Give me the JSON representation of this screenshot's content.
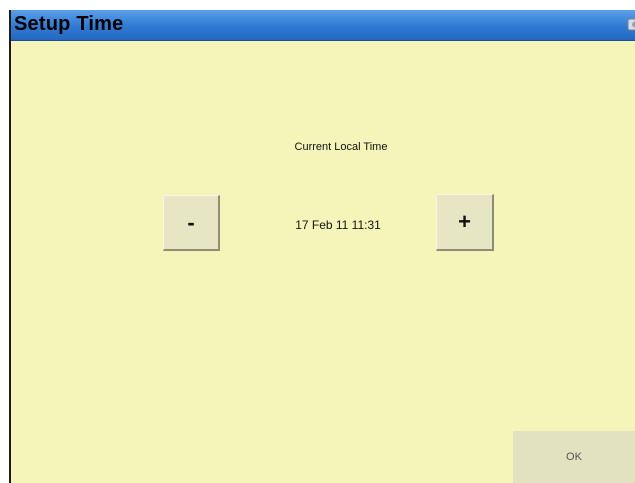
{
  "window": {
    "title": "Setup Time"
  },
  "time": {
    "label": "Current Local Time",
    "value": "17 Feb 11 11:31"
  },
  "buttons": {
    "decrement_label": "-",
    "increment_label": "+",
    "ok_label": "OK"
  },
  "icons": {
    "title_bar_icon": "settings-icon"
  },
  "colors": {
    "background": "#f5f5ba",
    "title_bar": "#2f7ad3",
    "button_face": "#e7e6c4"
  }
}
